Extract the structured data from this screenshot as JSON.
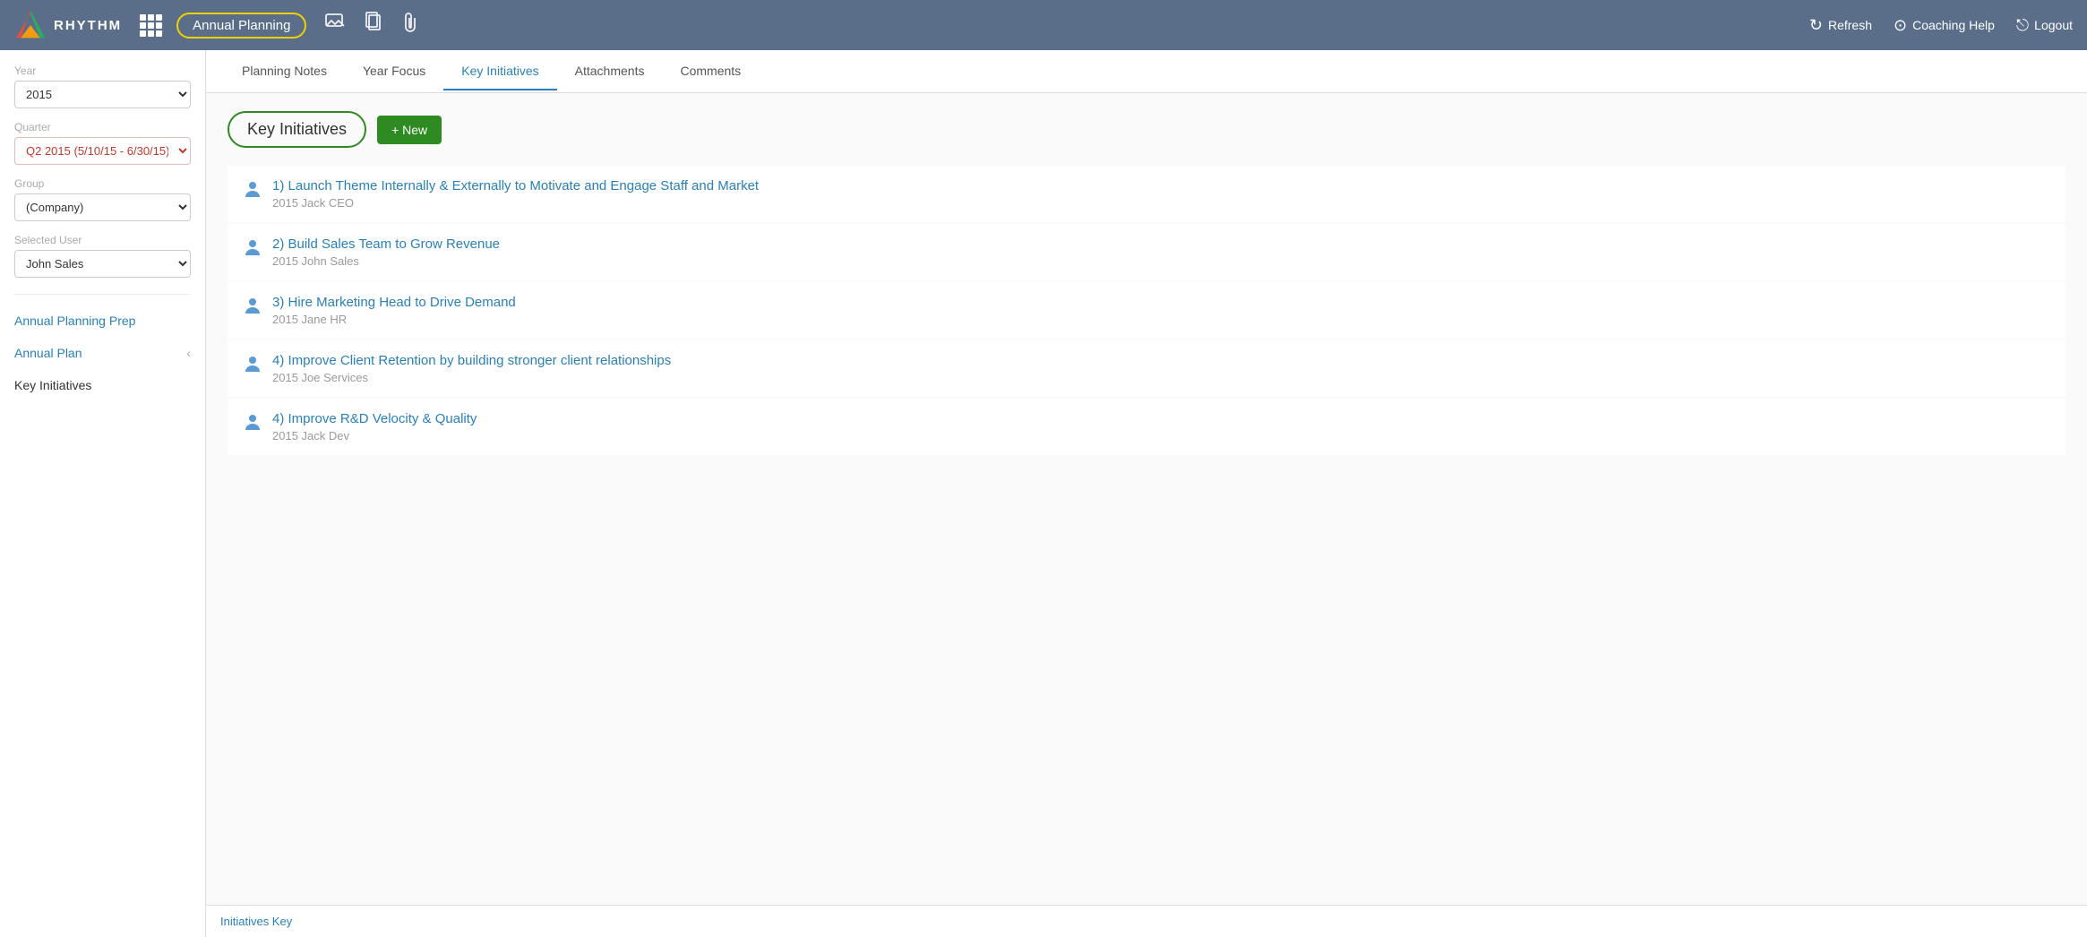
{
  "header": {
    "logo_text": "RHYTHM",
    "annual_planning_label": "Annual Planning",
    "icons": [
      "chat",
      "clipboard",
      "paperclip"
    ],
    "actions": [
      {
        "label": "Refresh",
        "icon": "↻"
      },
      {
        "label": "Coaching Help",
        "icon": "?"
      },
      {
        "label": "Logout",
        "icon": "⎋"
      }
    ]
  },
  "sidebar": {
    "year_label": "Year",
    "year_value": "2015",
    "quarter_label": "Quarter",
    "quarter_value": "Q2 2015 (5/10/15 - 6/30/15)",
    "group_label": "Group",
    "group_value": "(Company)",
    "selected_user_label": "Selected User",
    "selected_user_value": "John Sales",
    "nav_items": [
      {
        "label": "Annual Planning Prep",
        "arrow": false
      },
      {
        "label": "Annual Plan",
        "arrow": true
      },
      {
        "label": "Key Initiatives",
        "arrow": false
      }
    ]
  },
  "tabs": [
    {
      "label": "Planning Notes",
      "active": false
    },
    {
      "label": "Year Focus",
      "active": false
    },
    {
      "label": "Key Initiatives",
      "active": true
    },
    {
      "label": "Attachments",
      "active": false
    },
    {
      "label": "Comments",
      "active": false
    }
  ],
  "initiatives_section": {
    "title": "Key Initiatives",
    "new_button_label": "+ New",
    "items": [
      {
        "number": "1",
        "title": "1) Launch Theme Internally & Externally to Motivate and Engage Staff and Market",
        "meta": "2015 Jack CEO"
      },
      {
        "number": "2",
        "title": "2) Build Sales Team to Grow Revenue",
        "meta": "2015 John Sales"
      },
      {
        "number": "3",
        "title": "3) Hire Marketing Head to Drive Demand",
        "meta": "2015 Jane HR"
      },
      {
        "number": "4a",
        "title": "4) Improve Client Retention by building stronger client relationships",
        "meta": "2015 Joe Services"
      },
      {
        "number": "4b",
        "title": "4) Improve R&D Velocity & Quality",
        "meta": "2015 Jack Dev"
      }
    ]
  },
  "bottom_bar": {
    "label": "Initiatives Key"
  }
}
